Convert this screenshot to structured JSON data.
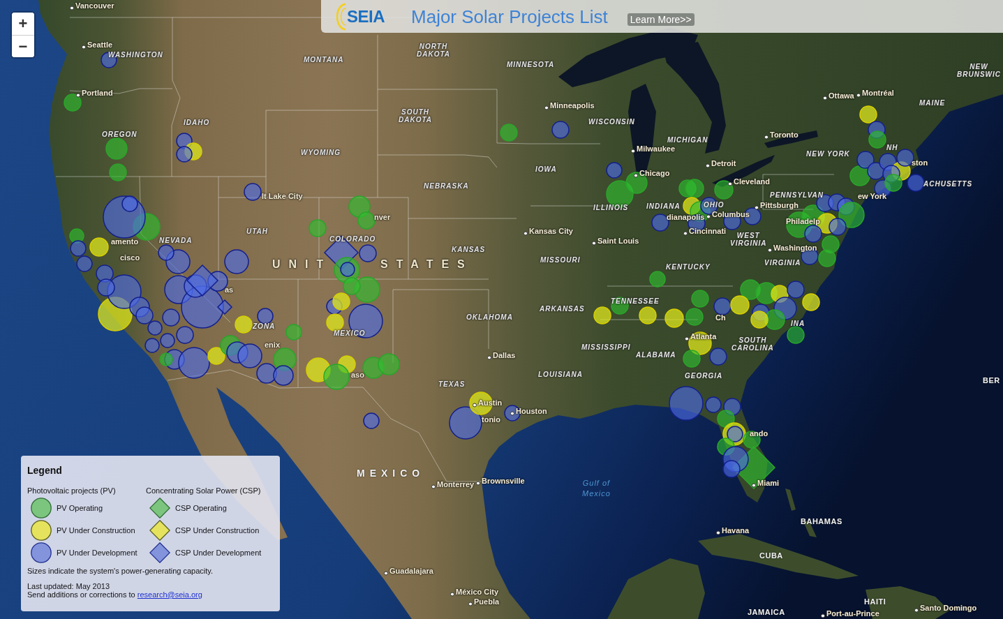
{
  "header": {
    "logo": "SEIA",
    "title": "Major Solar Projects List",
    "link": "Learn More>>"
  },
  "zoom_controls": [
    "+",
    "−"
  ],
  "map_labels": [
    {
      "kind": "city",
      "text": "Vancouver"
    },
    {
      "kind": "city",
      "text": "Seattle"
    },
    {
      "kind": "state",
      "text": "WASHINGTON"
    },
    {
      "kind": "state",
      "text": "MONTANA"
    },
    {
      "kind": "state",
      "lines": [
        "NORTH",
        "DAKOTA"
      ]
    },
    {
      "kind": "state",
      "text": "MINNESOTA"
    },
    {
      "kind": "state",
      "lines": [
        "NEW",
        "BRUNSWIC"
      ]
    },
    {
      "kind": "city",
      "text": "Portland"
    },
    {
      "kind": "city",
      "text": "Ottawa"
    },
    {
      "kind": "city",
      "text": "Montréal"
    },
    {
      "kind": "city",
      "text": "Minneapolis"
    },
    {
      "kind": "state",
      "text": "MAINE"
    },
    {
      "kind": "state",
      "text": "IDAHO"
    },
    {
      "kind": "state",
      "lines": [
        "SOUTH",
        "DAKOTA"
      ]
    },
    {
      "kind": "state",
      "text": "WISCONSIN"
    },
    {
      "kind": "state",
      "text": "OREGON"
    },
    {
      "kind": "state",
      "text": "MICHIGAN"
    },
    {
      "kind": "city",
      "text": "Toronto"
    },
    {
      "kind": "state",
      "text": "WYOMING"
    },
    {
      "kind": "city",
      "text": "Milwaukee"
    },
    {
      "kind": "state",
      "text": "NEW YORK"
    },
    {
      "kind": "state",
      "text": "NH"
    },
    {
      "kind": "state",
      "text": "IOWA"
    },
    {
      "kind": "city",
      "text": "Detroit"
    },
    {
      "kind": "city_part",
      "text": "ston"
    },
    {
      "kind": "city",
      "text": "Chicago"
    },
    {
      "kind": "state",
      "text": "NEBRASKA"
    },
    {
      "kind": "city",
      "text": "Cleveland"
    },
    {
      "kind": "state",
      "text": "ACHUSETTS"
    },
    {
      "kind": "city_part",
      "text": "lt Lake City"
    },
    {
      "kind": "state",
      "text": "PENNSYLVAN"
    },
    {
      "kind": "city_part",
      "text": "ew York"
    },
    {
      "kind": "state",
      "text": "ILLINOIS"
    },
    {
      "kind": "state",
      "text": "INDIANA"
    },
    {
      "kind": "state",
      "text": "OHIO"
    },
    {
      "kind": "city",
      "text": "Pittsburgh"
    },
    {
      "kind": "city_part",
      "text": "nver"
    },
    {
      "kind": "city_part",
      "text": "dianapolis"
    },
    {
      "kind": "city",
      "text": "Columbus"
    },
    {
      "kind": "city_part",
      "text": "Philadelp"
    },
    {
      "kind": "state",
      "text": "UTAH"
    },
    {
      "kind": "city",
      "text": "Kansas City"
    },
    {
      "kind": "city",
      "text": "Cincinnati"
    },
    {
      "kind": "city_part",
      "text": "amento"
    },
    {
      "kind": "state",
      "text": "NEVADA"
    },
    {
      "kind": "state",
      "text": "COLORADO"
    },
    {
      "kind": "city",
      "text": "Saint Louis"
    },
    {
      "kind": "state",
      "lines": [
        "WEST",
        "VIRGINIA"
      ]
    },
    {
      "kind": "state",
      "text": "KANSAS"
    },
    {
      "kind": "city",
      "text": "Washington"
    },
    {
      "kind": "city_part",
      "text": "cisco"
    },
    {
      "kind": "country_wide",
      "text": "UNIT"
    },
    {
      "kind": "country_wide",
      "text": "STATES"
    },
    {
      "kind": "state",
      "text": "MISSOURI"
    },
    {
      "kind": "state",
      "text": "KENTUCKY"
    },
    {
      "kind": "state",
      "text": "VIRGINIA"
    },
    {
      "kind": "city_part",
      "text": "as"
    },
    {
      "kind": "state",
      "text": "TENNESSEE"
    },
    {
      "kind": "state",
      "text": "ARKANSAS"
    },
    {
      "kind": "state",
      "text": "OKLAHOMA"
    },
    {
      "kind": "city_part",
      "text": "Ch"
    },
    {
      "kind": "state",
      "text": "ZONA"
    },
    {
      "kind": "state",
      "text": "INA"
    },
    {
      "kind": "state",
      "text": "MEXICO"
    },
    {
      "kind": "city",
      "text": "Atlanta"
    },
    {
      "kind": "city_part",
      "text": "enix"
    },
    {
      "kind": "state",
      "text": "MISSISSIPPI"
    },
    {
      "kind": "state",
      "lines": [
        "SOUTH",
        "CAROLINA"
      ]
    },
    {
      "kind": "city",
      "text": "Dallas"
    },
    {
      "kind": "state",
      "text": "ALABAMA"
    },
    {
      "kind": "city_part",
      "text": "aso"
    },
    {
      "kind": "state",
      "text": "LOUISIANA"
    },
    {
      "kind": "state",
      "text": "GEORGIA"
    },
    {
      "kind": "state",
      "text": "TEXAS"
    },
    {
      "kind": "country",
      "text": "BER"
    },
    {
      "kind": "city",
      "text": "Austin"
    },
    {
      "kind": "city",
      "text": "Houston"
    },
    {
      "kind": "city_part",
      "text": "tonio"
    },
    {
      "kind": "city_part",
      "text": "ando"
    },
    {
      "kind": "country_spaced",
      "text": "MEXICO"
    },
    {
      "kind": "city",
      "text": "Monterrey"
    },
    {
      "kind": "city",
      "text": "Brownsville"
    },
    {
      "kind": "water",
      "lines": [
        "Gulf of",
        "Mexico"
      ]
    },
    {
      "kind": "city",
      "text": "Miami"
    },
    {
      "kind": "country",
      "text": "BAHAMAS"
    },
    {
      "kind": "city",
      "text": "Havana"
    },
    {
      "kind": "country",
      "text": "CUBA"
    },
    {
      "kind": "city",
      "text": "Guadalajara"
    },
    {
      "kind": "city",
      "text": "México City"
    },
    {
      "kind": "city",
      "text": "Puebla"
    },
    {
      "kind": "country",
      "text": "HAITI"
    },
    {
      "kind": "country",
      "text": "JAMAICA"
    },
    {
      "kind": "city",
      "text": "Port-au-Prince"
    },
    {
      "kind": "city",
      "text": "Santo Domingo"
    }
  ],
  "markers": [
    {
      "kind": "pv_development"
    },
    {
      "kind": "pv_operating"
    },
    {
      "kind": "pv_operating"
    },
    {
      "kind": "pv_operating"
    },
    {
      "kind": "pv_development"
    },
    {
      "kind": "pv_construction"
    },
    {
      "kind": "pv_development"
    },
    {
      "kind": "pv_development"
    },
    {
      "kind": "pv_operating"
    },
    {
      "kind": "pv_development"
    },
    {
      "kind": "pv_development"
    },
    {
      "kind": "pv_operating"
    },
    {
      "kind": "pv_development"
    },
    {
      "kind": "pv_construction"
    },
    {
      "kind": "pv_development"
    },
    {
      "kind": "pv_development"
    },
    {
      "kind": "pv_development"
    },
    {
      "kind": "pv_development"
    },
    {
      "kind": "pv_development"
    },
    {
      "kind": "pv_construction"
    },
    {
      "kind": "pv_development"
    },
    {
      "kind": "pv_development"
    },
    {
      "kind": "pv_development"
    },
    {
      "kind": "pv_development"
    },
    {
      "kind": "pv_development"
    },
    {
      "kind": "pv_development"
    },
    {
      "kind": "pv_development"
    },
    {
      "kind": "pv_development"
    },
    {
      "kind": "pv_development"
    },
    {
      "kind": "pv_development"
    },
    {
      "kind": "pv_development"
    },
    {
      "kind": "pv_development"
    },
    {
      "kind": "pv_development"
    },
    {
      "kind": "pv_development"
    },
    {
      "kind": "pv_development"
    },
    {
      "kind": "pv_construction"
    },
    {
      "kind": "pv_operating"
    },
    {
      "kind": "pv_development"
    },
    {
      "kind": "pv_development"
    },
    {
      "kind": "pv_construction"
    },
    {
      "kind": "pv_development"
    },
    {
      "kind": "pv_development"
    },
    {
      "kind": "pv_operating"
    },
    {
      "kind": "pv_development"
    },
    {
      "kind": "pv_operating"
    },
    {
      "kind": "pv_operating"
    },
    {
      "kind": "csp_development"
    },
    {
      "kind": "csp_development"
    },
    {
      "kind": "pv_operating"
    },
    {
      "kind": "pv_operating"
    },
    {
      "kind": "pv_operating"
    },
    {
      "kind": "csp_development"
    },
    {
      "kind": "pv_operating"
    },
    {
      "kind": "pv_development"
    },
    {
      "kind": "pv_development"
    },
    {
      "kind": "pv_operating"
    },
    {
      "kind": "pv_operating"
    },
    {
      "kind": "pv_development"
    },
    {
      "kind": "pv_construction"
    },
    {
      "kind": "pv_construction"
    },
    {
      "kind": "pv_development"
    },
    {
      "kind": "pv_construction"
    },
    {
      "kind": "pv_construction"
    },
    {
      "kind": "pv_operating"
    },
    {
      "kind": "pv_operating"
    },
    {
      "kind": "pv_operating"
    },
    {
      "kind": "pv_development"
    },
    {
      "kind": "pv_development"
    },
    {
      "kind": "pv_construction"
    },
    {
      "kind": "pv_development"
    },
    {
      "kind": "pv_operating"
    },
    {
      "kind": "pv_development"
    },
    {
      "kind": "pv_development"
    },
    {
      "kind": "pv_operating"
    },
    {
      "kind": "pv_operating"
    },
    {
      "kind": "pv_development"
    },
    {
      "kind": "pv_operating"
    },
    {
      "kind": "pv_operating"
    },
    {
      "kind": "pv_construction"
    },
    {
      "kind": "pv_operating"
    },
    {
      "kind": "pv_development"
    },
    {
      "kind": "pv_development"
    },
    {
      "kind": "pv_development"
    },
    {
      "kind": "pv_operating"
    },
    {
      "kind": "pv_development"
    },
    {
      "kind": "pv_operating"
    },
    {
      "kind": "pv_construction"
    },
    {
      "kind": "pv_development"
    },
    {
      "kind": "pv_operating"
    },
    {
      "kind": "pv_operating"
    },
    {
      "kind": "pv_development"
    },
    {
      "kind": "pv_development"
    },
    {
      "kind": "pv_development"
    },
    {
      "kind": "pv_construction"
    },
    {
      "kind": "pv_development"
    },
    {
      "kind": "pv_development"
    },
    {
      "kind": "pv_development"
    },
    {
      "kind": "pv_development"
    },
    {
      "kind": "pv_operating"
    },
    {
      "kind": "pv_operating"
    },
    {
      "kind": "pv_operating"
    },
    {
      "kind": "pv_development"
    },
    {
      "kind": "pv_development"
    },
    {
      "kind": "pv_development"
    },
    {
      "kind": "pv_operating"
    },
    {
      "kind": "pv_construction"
    },
    {
      "kind": "pv_development"
    },
    {
      "kind": "pv_development"
    },
    {
      "kind": "pv_development"
    },
    {
      "kind": "pv_operating"
    },
    {
      "kind": "pv_operating"
    },
    {
      "kind": "pv_operating"
    },
    {
      "kind": "pv_operating"
    },
    {
      "kind": "pv_operating"
    },
    {
      "kind": "pv_development"
    },
    {
      "kind": "pv_construction"
    },
    {
      "kind": "pv_construction"
    },
    {
      "kind": "pv_development"
    },
    {
      "kind": "pv_construction"
    },
    {
      "kind": "pv_development"
    },
    {
      "kind": "pv_development"
    },
    {
      "kind": "pv_operating"
    },
    {
      "kind": "pv_construction"
    },
    {
      "kind": "pv_operating"
    },
    {
      "kind": "pv_operating"
    },
    {
      "kind": "pv_construction"
    },
    {
      "kind": "pv_construction"
    },
    {
      "kind": "pv_construction"
    },
    {
      "kind": "pv_operating"
    },
    {
      "kind": "pv_construction"
    },
    {
      "kind": "pv_operating"
    },
    {
      "kind": "pv_development"
    },
    {
      "kind": "pv_development"
    },
    {
      "kind": "pv_development"
    },
    {
      "kind": "pv_development"
    },
    {
      "kind": "pv_operating"
    },
    {
      "kind": "pv_construction"
    },
    {
      "kind": "pv_development"
    },
    {
      "kind": "pv_operating"
    },
    {
      "kind": "csp_operating"
    },
    {
      "kind": "pv_operating"
    },
    {
      "kind": "pv_development"
    },
    {
      "kind": "pv_development"
    }
  ],
  "legend": {
    "title": "Legend",
    "groups": [
      {
        "heading": "Photovoltaic projects (PV)",
        "items": [
          {
            "kind": "pv_operating",
            "label": "PV Operating"
          },
          {
            "kind": "pv_construction",
            "label": "PV Under Construction"
          },
          {
            "kind": "pv_development",
            "label": "PV Under Development"
          }
        ]
      },
      {
        "heading": "Concentrating Solar Power (CSP)",
        "items": [
          {
            "kind": "csp_operating",
            "label": "CSP Operating"
          },
          {
            "kind": "csp_construction",
            "label": "CSP Under Construction"
          },
          {
            "kind": "csp_development",
            "label": "CSP Under Development"
          }
        ]
      }
    ],
    "note": "Sizes indicate the system's power-generating capacity.",
    "updated": "Last updated: May 2013",
    "contact": "Send additions or corrections to",
    "contact_link": "research@seia.org"
  }
}
